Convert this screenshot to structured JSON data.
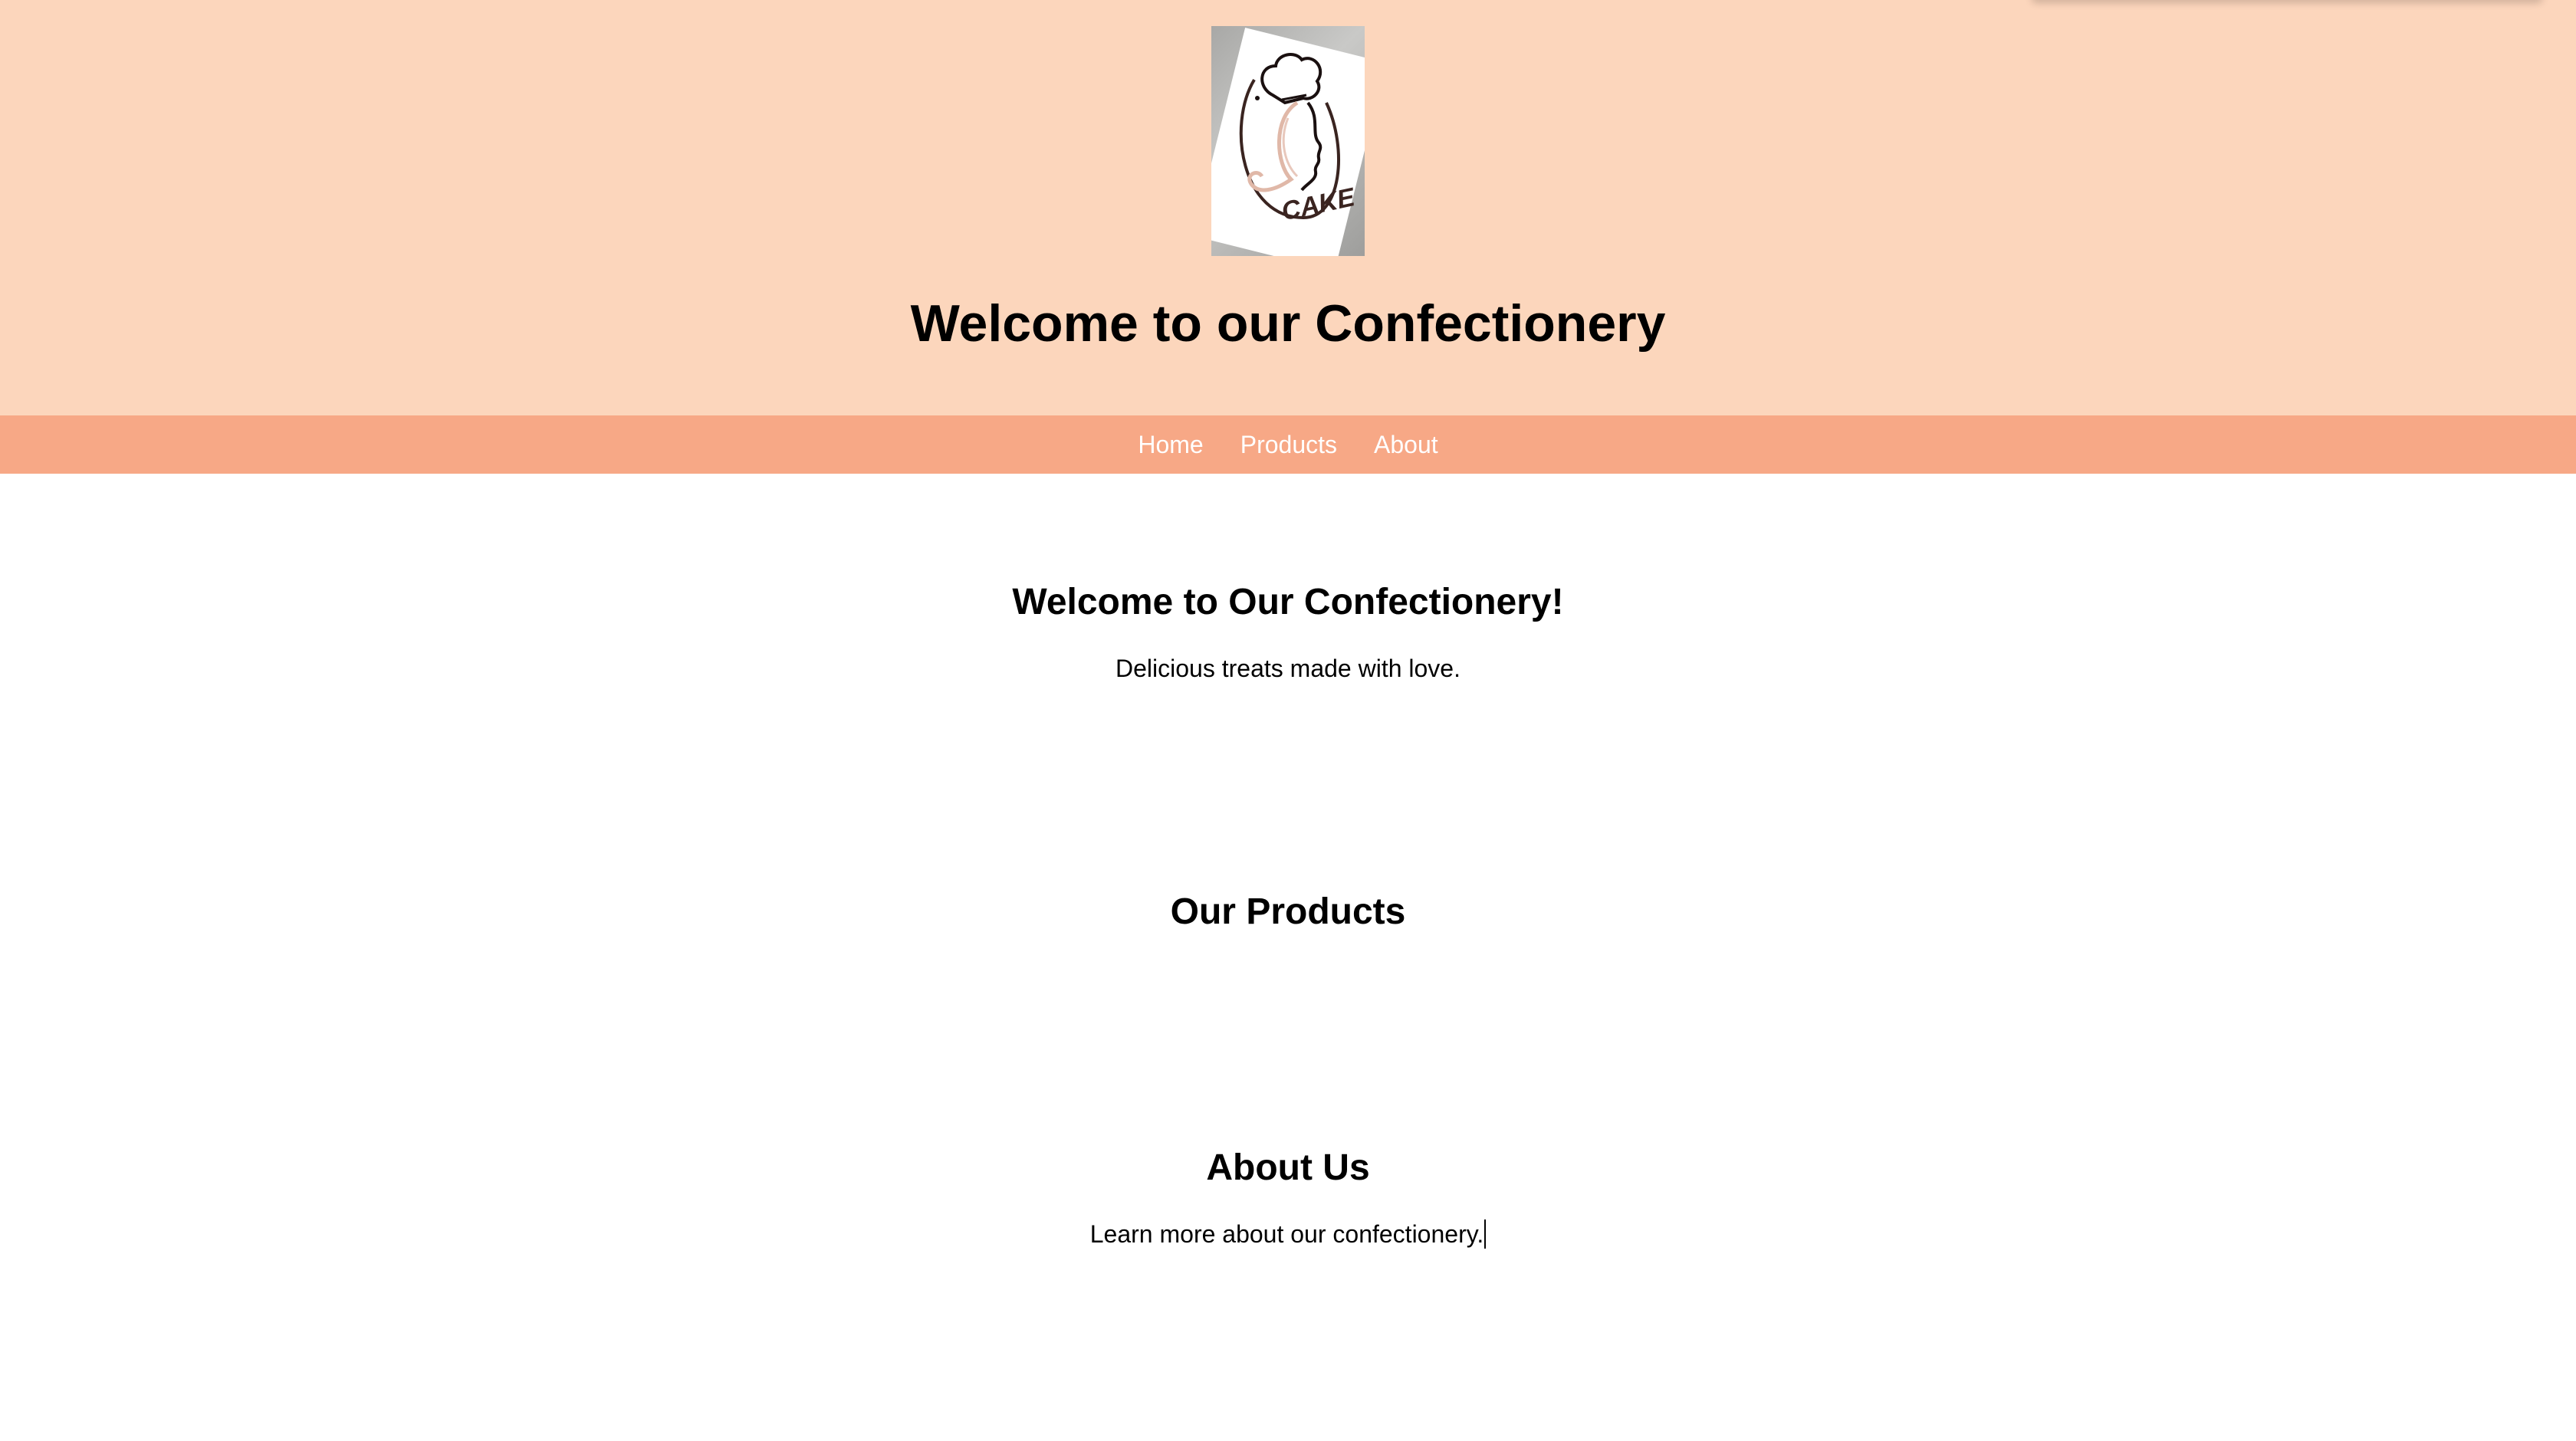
{
  "header": {
    "logo_alt": "CAKE",
    "title": "Welcome to our Confectionery"
  },
  "nav": {
    "items": [
      "Home",
      "Products",
      "About"
    ]
  },
  "hero": {
    "heading": "Welcome to Our Confectionery!",
    "text": "Delicious treats made with love."
  },
  "products": {
    "heading": "Our Products"
  },
  "about": {
    "heading": "About Us",
    "text": "Learn more about our confectionery."
  },
  "colors": {
    "header_bg": "#fcd6bc",
    "nav_bg": "#f7a886",
    "nav_text": "#ffffff"
  }
}
